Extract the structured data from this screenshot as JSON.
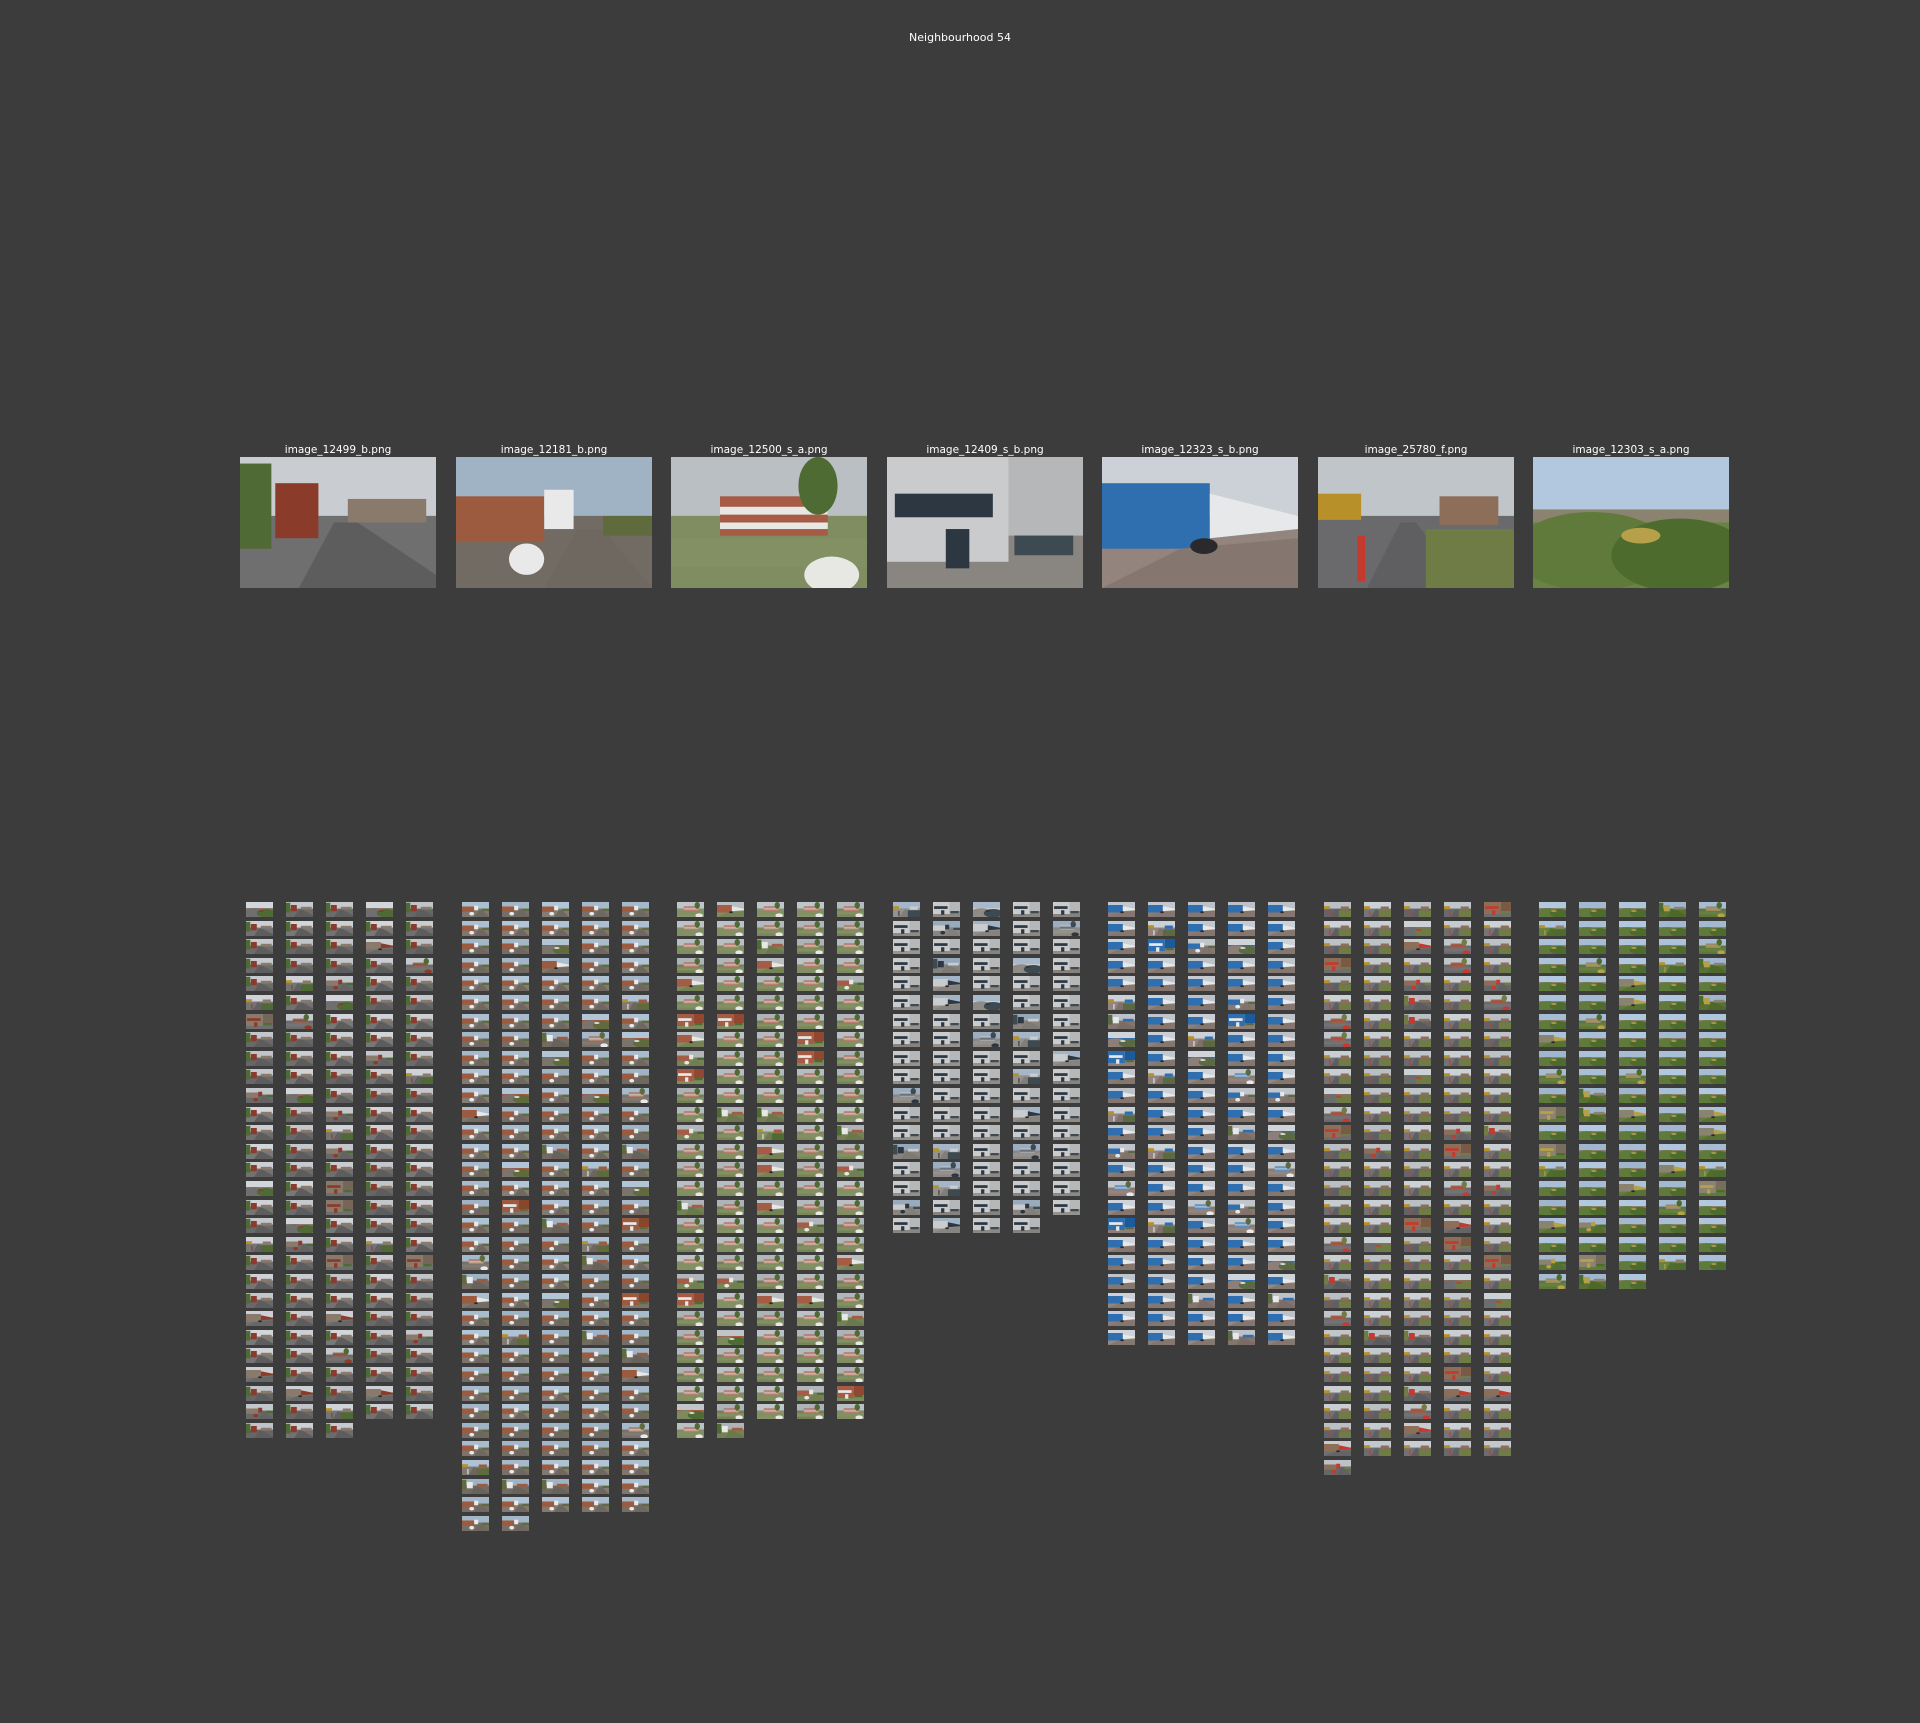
{
  "page": {
    "title": "Neighbourhood 54",
    "background_color": "#3c3c3c"
  },
  "clusters": [
    {
      "label": "image_12499_b.png",
      "scene": "street",
      "palette": {
        "sky": "#c9ccd0",
        "mid": "#8a7a6c",
        "ground": "#6f6f70",
        "accent": "#8a3b2a",
        "green": "#4f6a35"
      },
      "thumbnail_column_counts": [
        29,
        29,
        29,
        28,
        28
      ]
    },
    {
      "label": "image_12181_b.png",
      "scene": "building-street",
      "palette": {
        "sky": "#a9bccd",
        "mid": "#9c5a3e",
        "ground": "#7b746d",
        "accent": "#e9e9e9",
        "green": "#5f6b3d"
      },
      "thumbnail_column_counts": [
        34,
        34,
        33,
        33,
        33
      ]
    },
    {
      "label": "image_12500_s_a.png",
      "scene": "building-field",
      "palette": {
        "sky": "#b7bcc1",
        "mid": "#a55b44",
        "ground": "#7d8a5e",
        "accent": "#e7e7e4",
        "green": "#4d6b33"
      },
      "thumbnail_column_counts": [
        29,
        29,
        28,
        28,
        28
      ]
    },
    {
      "label": "image_12409_s_b.png",
      "scene": "storefront",
      "palette": {
        "sky": "#9eb0c2",
        "mid": "#c9cbcd",
        "ground": "#8f8b86",
        "accent": "#2d3742",
        "green": "#3e4a52"
      },
      "thumbnail_column_counts": [
        18,
        18,
        18,
        18,
        17
      ]
    },
    {
      "label": "image_12323_s_b.png",
      "scene": "warehouse",
      "palette": {
        "sky": "#c6cbd1",
        "mid": "#2f6fb0",
        "ground": "#8d7f77",
        "accent": "#e6e8ea",
        "green": "#5c6a44"
      },
      "thumbnail_column_counts": [
        24,
        24,
        24,
        24,
        24
      ]
    },
    {
      "label": "image_25780_f.png",
      "scene": "road",
      "palette": {
        "sky": "#c3c8cd",
        "mid": "#8d6e58",
        "ground": "#6d6d6f",
        "accent": "#c23b2e",
        "green": "#6f7c46"
      },
      "thumbnail_column_counts": [
        31,
        30,
        30,
        30,
        30
      ]
    },
    {
      "label": "image_12303_s_a.png",
      "scene": "bushes",
      "palette": {
        "sky": "#a9bfd6",
        "mid": "#8c8270",
        "ground": "#5f7a3a",
        "accent": "#b7a04a",
        "green": "#4e6b2e"
      },
      "thumbnail_column_counts": [
        21,
        21,
        21,
        20,
        20
      ]
    }
  ]
}
